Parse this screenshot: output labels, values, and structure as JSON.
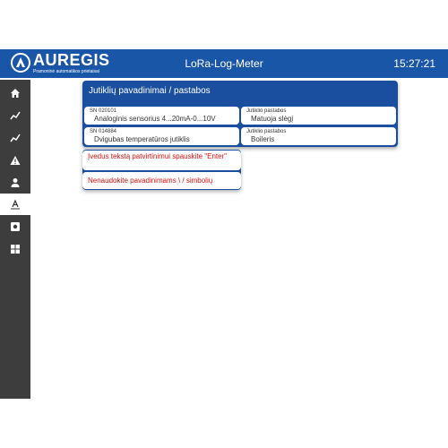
{
  "header": {
    "logo_name": "AUREGIS",
    "logo_subtitle": "Pramoninė automatikos prietaisai",
    "app_title": "LoRa-Log-Meter",
    "clock": "15:27:21"
  },
  "sidebar": {
    "items": [
      {
        "icon": "home-icon"
      },
      {
        "icon": "chart-line-icon"
      },
      {
        "icon": "chart-line-icon"
      },
      {
        "icon": "warning-icon"
      },
      {
        "icon": "user-icon"
      },
      {
        "icon": "text-font-icon",
        "active": true
      },
      {
        "icon": "settings-icon"
      },
      {
        "icon": "grid-icon"
      }
    ]
  },
  "panel": {
    "title": "Jutiklių pavadinimai / pastabos",
    "sensors": [
      {
        "sn": "SN 020101",
        "name": "Analoginis sensorius 4...20mA-0...10V",
        "note_label": "Jutiklio pastabos",
        "note": "Matuoja slėgį"
      },
      {
        "sn": "SN 014884",
        "name": "Dvigubas temperatūros jutiklis",
        "note_label": "Jutiklio pastabos",
        "note": "Boileris"
      }
    ]
  },
  "hints": [
    "Įvedus tekstą patvirtinimui spauskite \"Enter\"",
    "Nenaudokite pavadinimams \\ / simbolių"
  ],
  "colors": {
    "header": "#1a56a8",
    "sidebar": "#3d3d3d",
    "panel": "#1a4fa0",
    "warning_text": "#dd1111"
  }
}
